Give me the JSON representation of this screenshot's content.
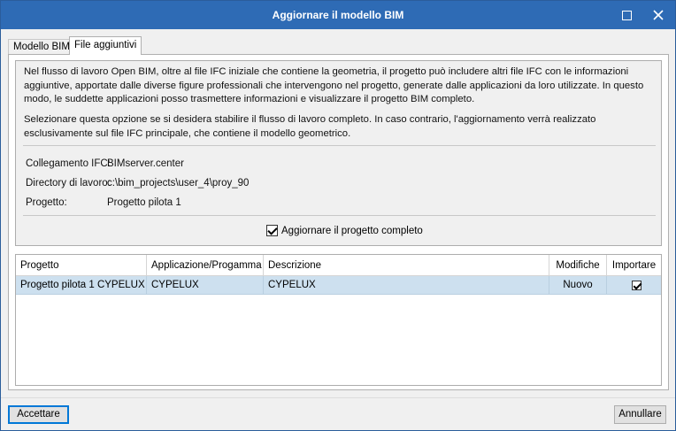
{
  "window": {
    "title": "Aggiornare il modello BIM"
  },
  "tabs": [
    {
      "label": "Modello BIM",
      "active": false
    },
    {
      "label": "File aggiuntivi",
      "active": true
    }
  ],
  "info": {
    "paragraph1": "Nel flusso di lavoro Open BIM, oltre al file IFC iniziale che contiene la geometria, il progetto può includere altri file IFC con le informazioni aggiuntive, apportate dalle diverse figure professionali che intervengono nel progetto, generate dalle applicazioni da loro utilizzate. In questo modo, le suddette applicazioni posso trasmettere informazioni e visualizzare il progetto BIM completo.",
    "paragraph2": "Selezionare questa opzione se si desidera stabilire il flusso di lavoro completo. In caso contrario, l'aggiornamento verrà realizzato esclusivamente sul file IFC principale, che contiene il modello geometrico.",
    "fields": [
      {
        "label": "Collegamento IFC:",
        "value": "BIMserver.center"
      },
      {
        "label": "Directory di lavoro:",
        "value": "c:\\bim_projects\\user_4\\proy_90"
      },
      {
        "label": "Progetto:",
        "value": "Progetto pilota 1"
      }
    ],
    "update_complete": {
      "label": "Aggiornare il progetto completo",
      "checked": true
    }
  },
  "table": {
    "columns": [
      "Progetto",
      "Applicazione/Progamma",
      "Descrizione",
      "Modifiche",
      "Importare"
    ],
    "rows": [
      {
        "progetto": "Progetto pilota 1 CYPELUX",
        "applicazione": "CYPELUX",
        "descrizione": "CYPELUX",
        "modifiche": "Nuovo",
        "importare": true
      }
    ]
  },
  "buttons": {
    "accept": "Accettare",
    "cancel": "Annullare"
  },
  "colors": {
    "titlebar": "#2e6bb5",
    "selected_row": "#cde0ef",
    "default_button_border": "#0078d7"
  },
  "icons": {
    "maximize": "maximize-icon",
    "close": "close-icon",
    "checkbox_checked": "checkbox-checked-icon"
  }
}
